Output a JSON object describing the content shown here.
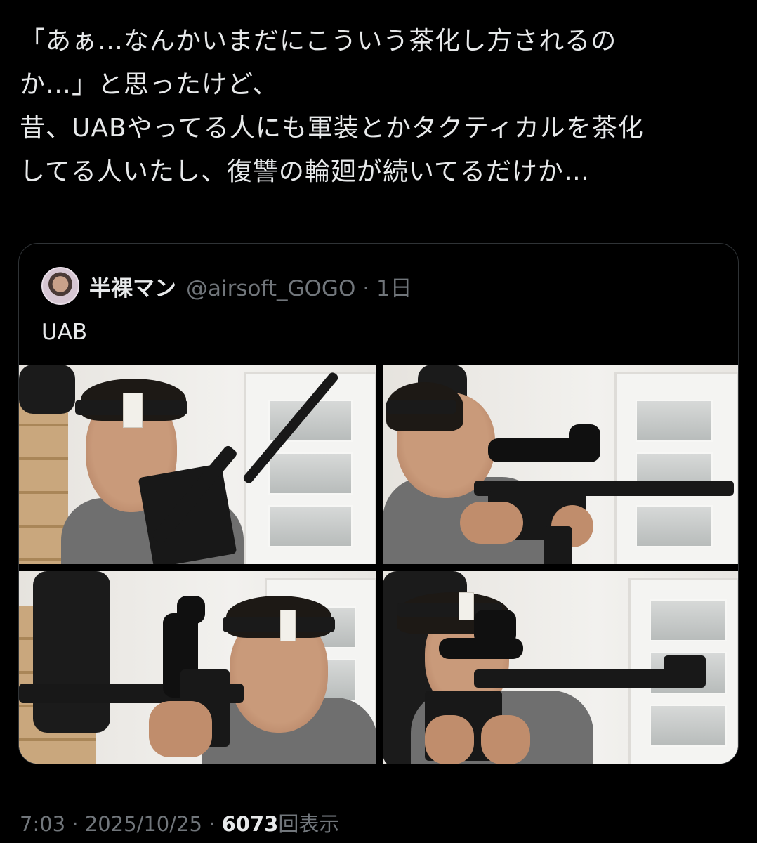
{
  "tweet": {
    "lines": [
      "「あぁ…なんかいまだにこういう茶化し方されるの",
      "か…」と思ったけど、",
      "昔、UABやってる人にも軍装とかタクティカルを茶化",
      "してる人いたし、復讐の輪廻が続いてるだけか…"
    ]
  },
  "quote": {
    "author_name": "半裸マン",
    "author_handle": "@airsoft_GOGO",
    "separator": "·",
    "age": "1日",
    "text": "UAB",
    "photos": [
      {
        "name": "photo-1"
      },
      {
        "name": "photo-2"
      },
      {
        "name": "photo-3"
      },
      {
        "name": "photo-4"
      }
    ]
  },
  "footer": {
    "time": "7:03",
    "separator": "·",
    "date": "2025/10/25",
    "views_count": "6073",
    "views_label": "回表示"
  },
  "colors": {
    "background": "#000000",
    "text_primary": "#e7e9ea",
    "text_secondary": "#71767b",
    "card_border": "#2f3336"
  }
}
